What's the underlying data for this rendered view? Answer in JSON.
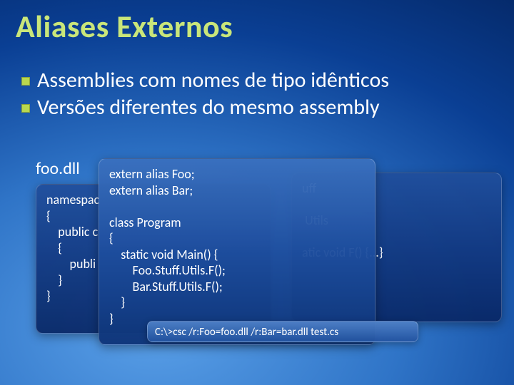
{
  "title": "Aliases Externos",
  "bullets": [
    "Assemblies com nomes de tipo idênticos",
    "Versões diferentes do mesmo assembly"
  ],
  "foo_label": "foo.dll",
  "code_left": "namespac\n{\n    public c\n    {\n        publi\n    }\n}",
  "code_right": "uff\n\n Utils\n\natic void F() {...}",
  "code_front": "extern alias Foo;\nextern alias Bar;\n\nclass Program\n{\n    static void Main() {\n        Foo.Stuff.Utils.F();\n        Bar.Stuff.Utils.F();\n    }\n}",
  "cmd": "C:\\>csc /r:Foo=foo.dll /r:Bar=bar.dll test.cs"
}
